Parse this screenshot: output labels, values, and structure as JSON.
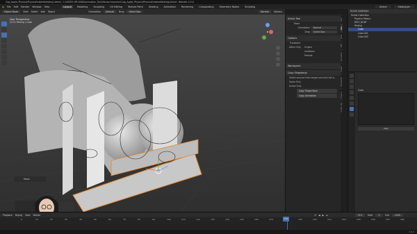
{
  "titlebar": {
    "text": "Cag_Apple_Physics(PhysicsEnabledVerbing).blend - C:\\VIDEO UPLOADS\\animation_Test.Mouse.improved.Cag_Apple_Physics(PhysicsEnabledVerbing).blend - Blender 4.3.0"
  },
  "menubar": {
    "menus": [
      "File",
      "Edit",
      "Render",
      "Window",
      "Help"
    ],
    "workspaces": [
      "Layout",
      "Modeling",
      "Sculpting",
      "UV Editing",
      "Texture Paint",
      "Shading",
      "Animation",
      "Rendering",
      "Compositing",
      "Geometry Nodes",
      "Scripting"
    ],
    "active_workspace": "Layout",
    "scene": "Scene",
    "view_layer": "ViewLayer"
  },
  "viewport_header": {
    "mode": "Object Mode",
    "menus": [
      "View",
      "Select",
      "Add",
      "Object"
    ],
    "orientation_label": "Orientation",
    "orientation_value": "Default",
    "drag_label": "Drag",
    "drag_value": "Select Box",
    "transform_pivot": "Normal",
    "options_label": "Options"
  },
  "viewport": {
    "overlay_line1": "User Perspective",
    "overlay_line2": "(213) Testing | Cube",
    "last_operator": "Move",
    "camera_rig_label": "Move"
  },
  "npanel": {
    "active_tool_title": "Active Tool",
    "tool_name": "Move",
    "orientation_label": "Orientation",
    "orientation_value": "Normal",
    "drag_label": "Drag",
    "drag_value": "Select Box",
    "options_title": "Options",
    "transform_title": "Transform",
    "affect_only": "Affect Only",
    "origins": "Origins",
    "locations": "Locations",
    "parents": "Parents",
    "workspace_title": "Workspace",
    "copy_shapekeys_title": "Copy Shapekeys",
    "copy_desc": "Select sources then target and click the b...",
    "same_only": "Same Only",
    "active_only": "Active Only",
    "copy_shape_keys_btn": "Copy Shape Keys",
    "copy_animation_btn": "Copy Animation"
  },
  "ntabs": [
    "Item",
    "Tool",
    "View",
    "Edit",
    "Animation",
    "Create",
    "BlenderKit",
    "Physics",
    "Create Rig",
    "Auto-Rig Pro",
    "Dynamics",
    "Shape Keys",
    "Copy Attr"
  ],
  "outliner": {
    "title": "Scene Collection",
    "items": [
      {
        "label": "Scene Collection",
        "indent": 0,
        "selected": false
      },
      {
        "label": "Physics History",
        "indent": 1,
        "selected": false
      },
      {
        "label": "DELT_BODY",
        "indent": 1,
        "selected": false
      },
      {
        "label": "Testing",
        "indent": 1,
        "selected": false
      },
      {
        "label": "Cube",
        "indent": 2,
        "selected": true
      },
      {
        "label": "Cube.001",
        "indent": 2,
        "selected": false
      },
      {
        "label": "Cube.002",
        "indent": 2,
        "selected": false
      }
    ]
  },
  "properties": {
    "object_name": "Cube",
    "new_button": "New"
  },
  "timeline": {
    "label": "Playback",
    "menus": [
      "Keying",
      "View",
      "Marker"
    ],
    "current_frame": "213",
    "start_label": "Start",
    "start_value": "1",
    "end_label": "End",
    "end_value": "2200",
    "ticks": [
      "0",
      "10",
      "20",
      "30",
      "40",
      "50",
      "60",
      "70",
      "80",
      "90",
      "100",
      "110",
      "120",
      "130",
      "140",
      "150",
      "160",
      "170",
      "180",
      "190",
      "200",
      "210",
      "220",
      "230",
      "240",
      "250",
      "260"
    ]
  },
  "statusbar": {
    "version": "4.3.0"
  },
  "colors": {
    "accent": "#4772b3",
    "selection_orange": "#e8862a",
    "active_blue": "#334d80"
  }
}
